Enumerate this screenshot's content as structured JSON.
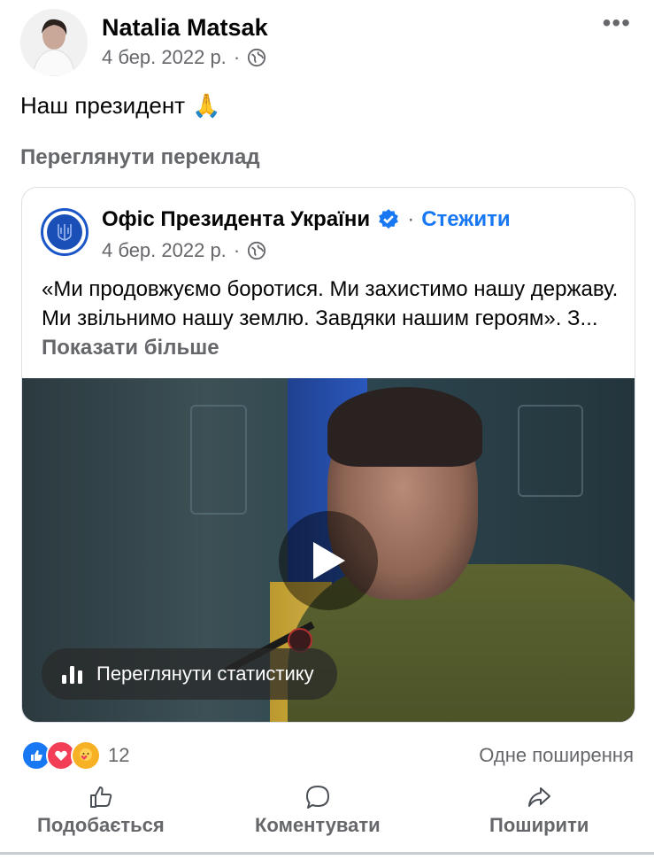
{
  "post": {
    "author_name": "Natalia Matsak",
    "date": "4 бер. 2022 р.",
    "separator": "·",
    "privacy_icon": "globe-icon",
    "more_icon": "•••",
    "text": "Наш президент",
    "text_emoji": "🙏",
    "see_translation": "Переглянути переклад"
  },
  "shared": {
    "page_name": "Офіс Президента України",
    "separator": "·",
    "follow_label": "Стежити",
    "date": "4 бер. 2022 р.",
    "text": "«Ми продовжуємо боротися. Ми захистимо нашу державу. Ми звільнимо нашу землю. Завдяки нашим героям». З...",
    "show_more": "Показати більше",
    "video": {
      "stats_label": "Переглянути статистику"
    }
  },
  "engagement": {
    "reaction_count": "12",
    "shares": "Одне поширення",
    "reactions": [
      "like",
      "love",
      "care"
    ]
  },
  "actions": {
    "like": "Подобається",
    "comment": "Коментувати",
    "share": "Поширити"
  },
  "colors": {
    "accent": "#1877f2",
    "secondary_text": "#65676b"
  }
}
